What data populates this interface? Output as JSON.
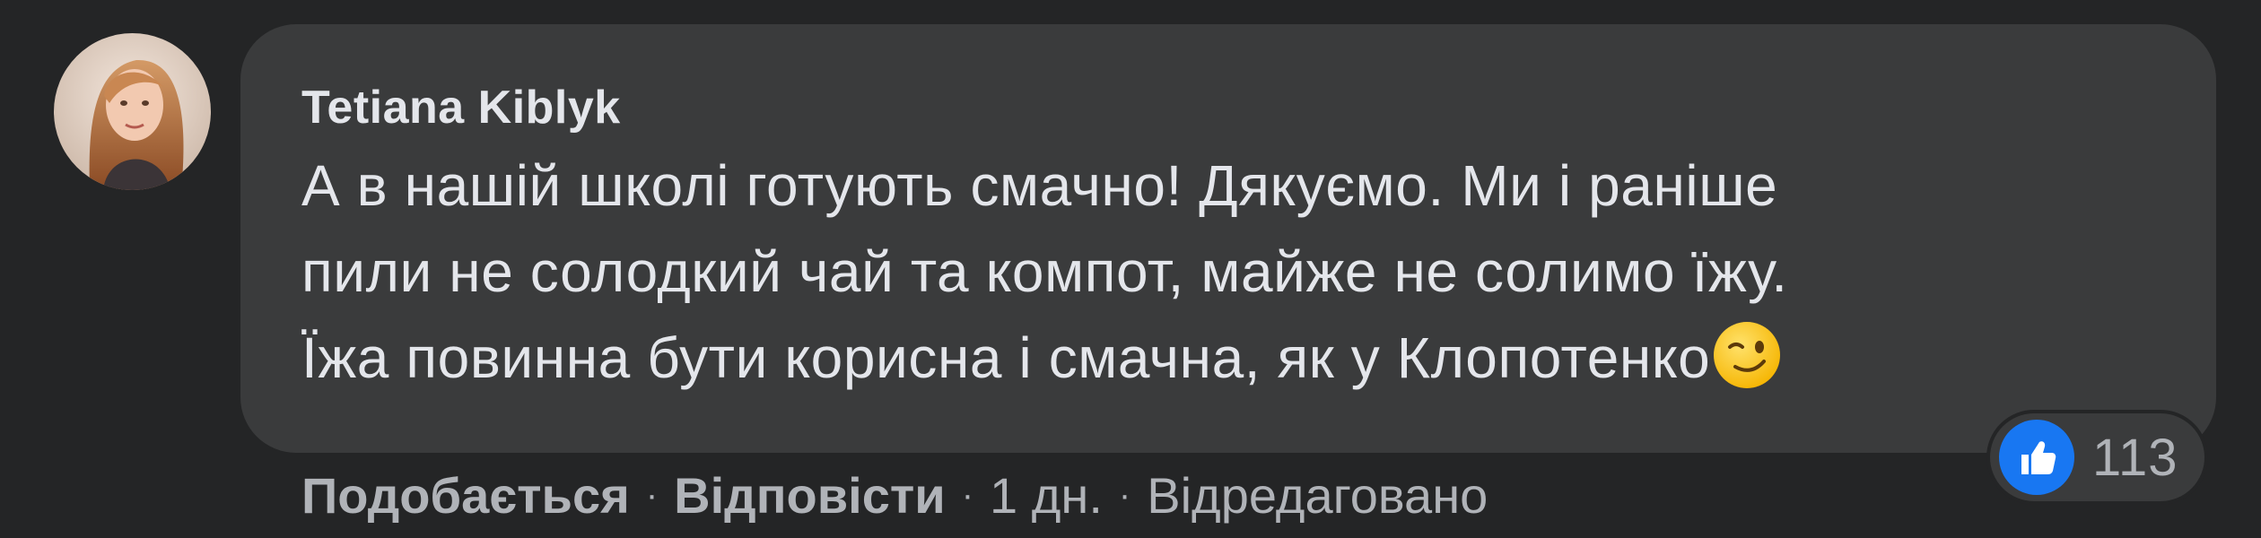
{
  "comment": {
    "author": "Tetiana Kiblyk",
    "text": "А в нашій школі готують смачно! Дякуємо. Ми і раніше\nпили не солодкий чай та компот, майже не солимо їжу.\nЇжа повинна бути корисна і смачна, як у Клопотенко",
    "emoji": "winking-face-icon",
    "avatar": "user-avatar"
  },
  "reactions": {
    "icon": "like-thumb-icon",
    "count": "113",
    "color": "#1877f2"
  },
  "actions": {
    "like_label": "Подобається",
    "reply_label": "Відповісти",
    "separator": "·",
    "time": "1 дн.",
    "edited": "Відредаговано"
  },
  "colors": {
    "page_bg": "#242526",
    "bubble_bg": "#3a3b3c",
    "primary_text": "#e4e6eb",
    "secondary_text": "#b0b3b8",
    "like_blue": "#1877f2"
  }
}
